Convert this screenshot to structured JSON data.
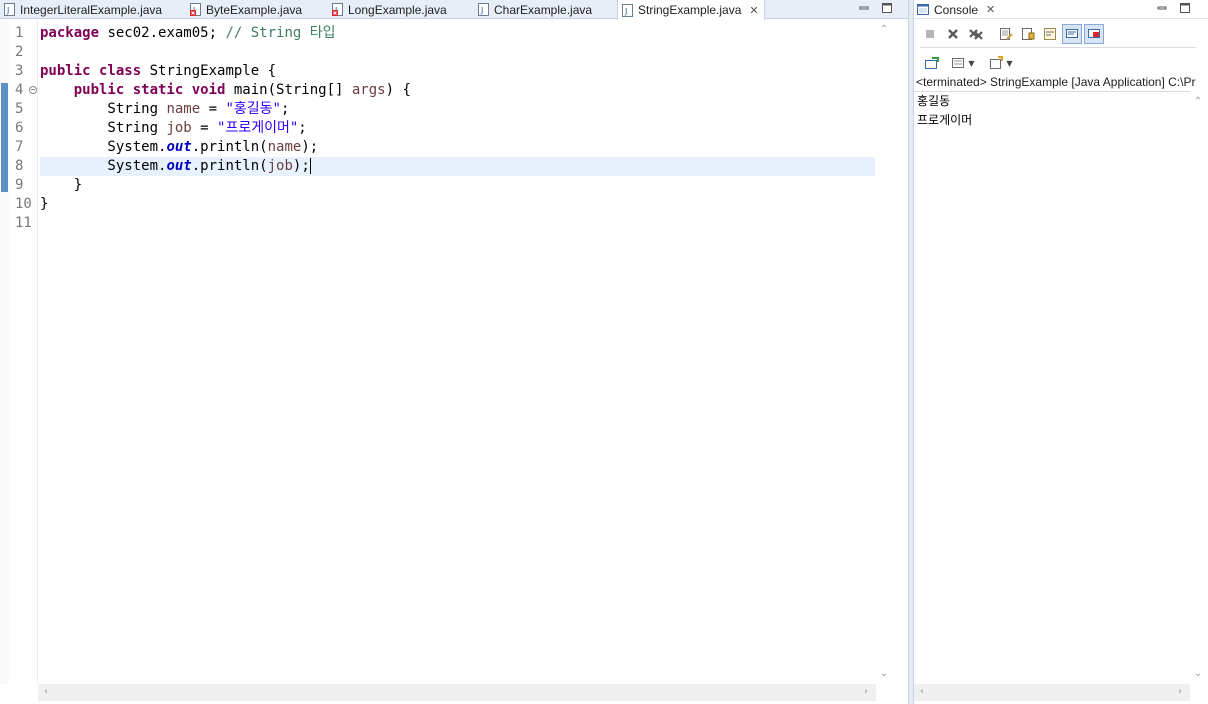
{
  "editor": {
    "tabs": [
      {
        "label": "IntegerLiteralExample.java",
        "icon": "java-file-icon",
        "active": false
      },
      {
        "label": "ByteExample.java",
        "icon": "java-file-error-icon",
        "active": false
      },
      {
        "label": "LongExample.java",
        "icon": "java-file-error-icon",
        "active": false
      },
      {
        "label": "CharExample.java",
        "icon": "java-file-icon",
        "active": false
      },
      {
        "label": "StringExample.java",
        "icon": "java-file-icon",
        "active": true
      }
    ],
    "line_numbers": [
      "1",
      "2",
      "3",
      "4",
      "5",
      "6",
      "7",
      "8",
      "9",
      "10",
      "11"
    ],
    "current_line": 8,
    "code": {
      "l1_kw": "package",
      "l1_text": " sec02.exam05; ",
      "l1_comment": "// String 타입",
      "l3_kw": "public class",
      "l3_text": " StringExample {",
      "l4_indent": "    ",
      "l4_kw": "public static void",
      "l4_text1": " main(String[] ",
      "l4_param": "args",
      "l4_text2": ") {",
      "l5_text1": "        String ",
      "l5_var": "name",
      "l5_text2": " = ",
      "l5_str": "\"홍길동\"",
      "l5_text3": ";",
      "l6_text1": "        String ",
      "l6_var": "job",
      "l6_text2": " = ",
      "l6_str": "\"프로게이머\"",
      "l6_text3": ";",
      "l7_text1": "        System.",
      "l7_field": "out",
      "l7_text2": ".println(",
      "l7_var": "name",
      "l7_text3": ");",
      "l8_text1": "        System.",
      "l8_field": "out",
      "l8_text2": ".println(",
      "l8_var": "job",
      "l8_text3": ");",
      "l9_text": "    }",
      "l10_text": "}"
    }
  },
  "console": {
    "tab_label": "Console",
    "status": "<terminated> StringExample [Java Application] C:\\Pr",
    "output_lines": [
      "홍길동",
      "프로게이머"
    ]
  },
  "colors": {
    "keyword": "#7f0055",
    "comment": "#3f7f5f",
    "string": "#2a00ff",
    "local_var": "#6a3e3e",
    "static_field": "#0000c0",
    "current_line_bg": "#e8f2fe",
    "change_marker": "#5e8ec7"
  }
}
